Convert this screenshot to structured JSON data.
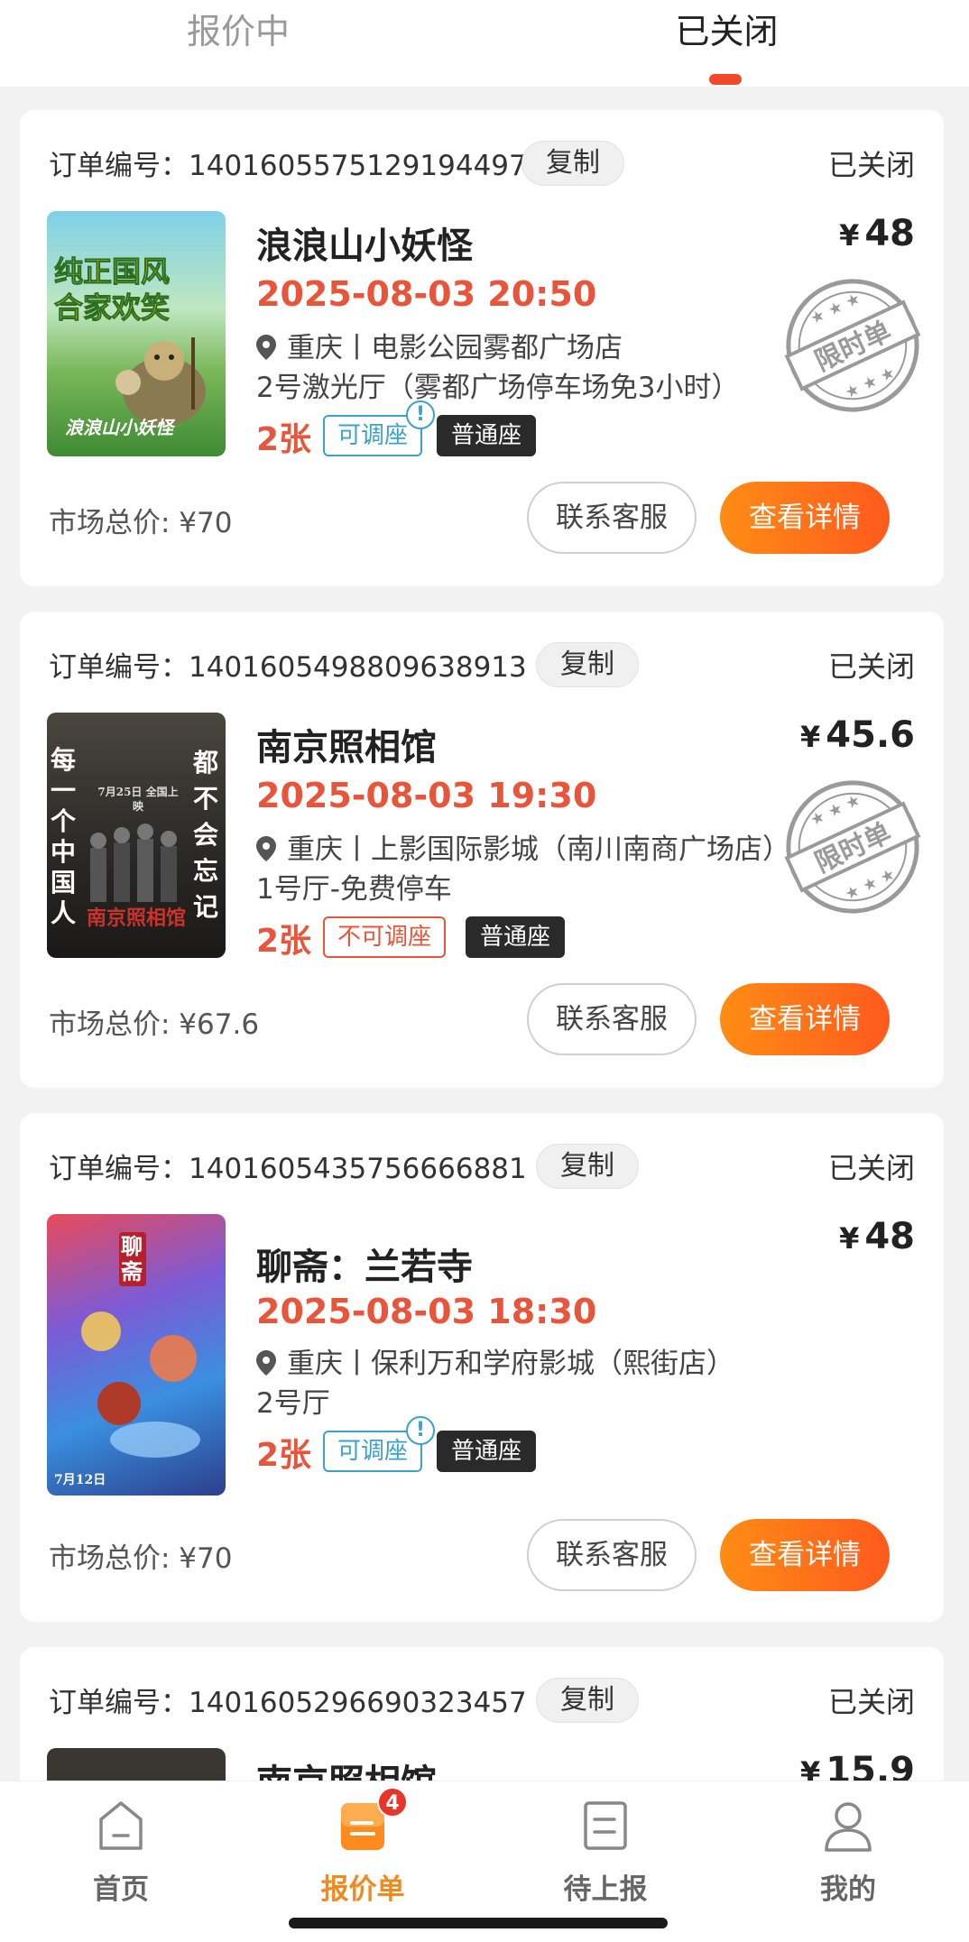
{
  "tabs": [
    {
      "label": "报价中"
    },
    {
      "label": "已关闭"
    }
  ],
  "colors": {
    "accent": "#f04a2a",
    "price_red": "#e8553a",
    "adjustable": "#3aa3c7",
    "detail_button": "#ff7a1a",
    "nav_active": "#f08a1e"
  },
  "orders": [
    {
      "order_label": "订单编号：1401605575129194497",
      "copy_label": "复制",
      "status": "已关闭",
      "title": "浪浪山小妖怪",
      "currency": "¥",
      "price": "48",
      "showtime": "2025-08-03 20:50",
      "location": "重庆丨电影公园雾都广场店",
      "hall": "2号激光厅（雾都广场停车场免3小时）",
      "qty": "2张",
      "seat_adjust": "可调座",
      "seat_type": "普通座",
      "stamp": "限时单",
      "market": "市场总价: ¥70",
      "contact_label": "联系客服",
      "detail_label": "查看详情",
      "poster_text": [
        "纯正国风",
        "合家欢笑",
        "浪浪山小妖怪"
      ]
    },
    {
      "order_label": "订单编号：1401605498809638913",
      "copy_label": "复制",
      "status": "已关闭",
      "title": "南京照相馆",
      "currency": "¥",
      "price": "45.6",
      "showtime": "2025-08-03 19:30",
      "location": "重庆丨上影国际影城（南川南商广场店）",
      "hall": "1号厅-免费停车",
      "qty": "2张",
      "seat_adjust": "不可调座",
      "seat_type": "普通座",
      "stamp": "限时单",
      "market": "市场总价: ¥67.6",
      "contact_label": "联系客服",
      "detail_label": "查看详情",
      "poster_text": [
        "每一个中国人",
        "都不会忘记",
        "南京照相馆",
        "7月25日 全国上映"
      ]
    },
    {
      "order_label": "订单编号：1401605435756666881",
      "copy_label": "复制",
      "status": "已关闭",
      "title": "聊斋：兰若寺",
      "currency": "¥",
      "price": "48",
      "showtime": "2025-08-03 18:30",
      "location": "重庆丨保利万和学府影城（熙街店）",
      "hall": "2号厅",
      "qty": "2张",
      "seat_adjust": "可调座",
      "seat_type": "普通座",
      "market": "市场总价: ¥70",
      "contact_label": "联系客服",
      "detail_label": "查看详情",
      "poster_text": [
        "聊斋",
        "7月12日"
      ]
    },
    {
      "order_label": "订单编号：1401605296690323457",
      "copy_label": "复制",
      "status": "已关闭",
      "title": "南京照相馆",
      "currency": "¥",
      "price": "15.9"
    }
  ],
  "bottom_nav": [
    {
      "label": "首页",
      "icon": "home-icon"
    },
    {
      "label": "报价单",
      "icon": "quote-list-icon",
      "badge": "4",
      "active": true
    },
    {
      "label": "待上报",
      "icon": "pending-report-icon"
    },
    {
      "label": "我的",
      "icon": "profile-icon"
    }
  ]
}
